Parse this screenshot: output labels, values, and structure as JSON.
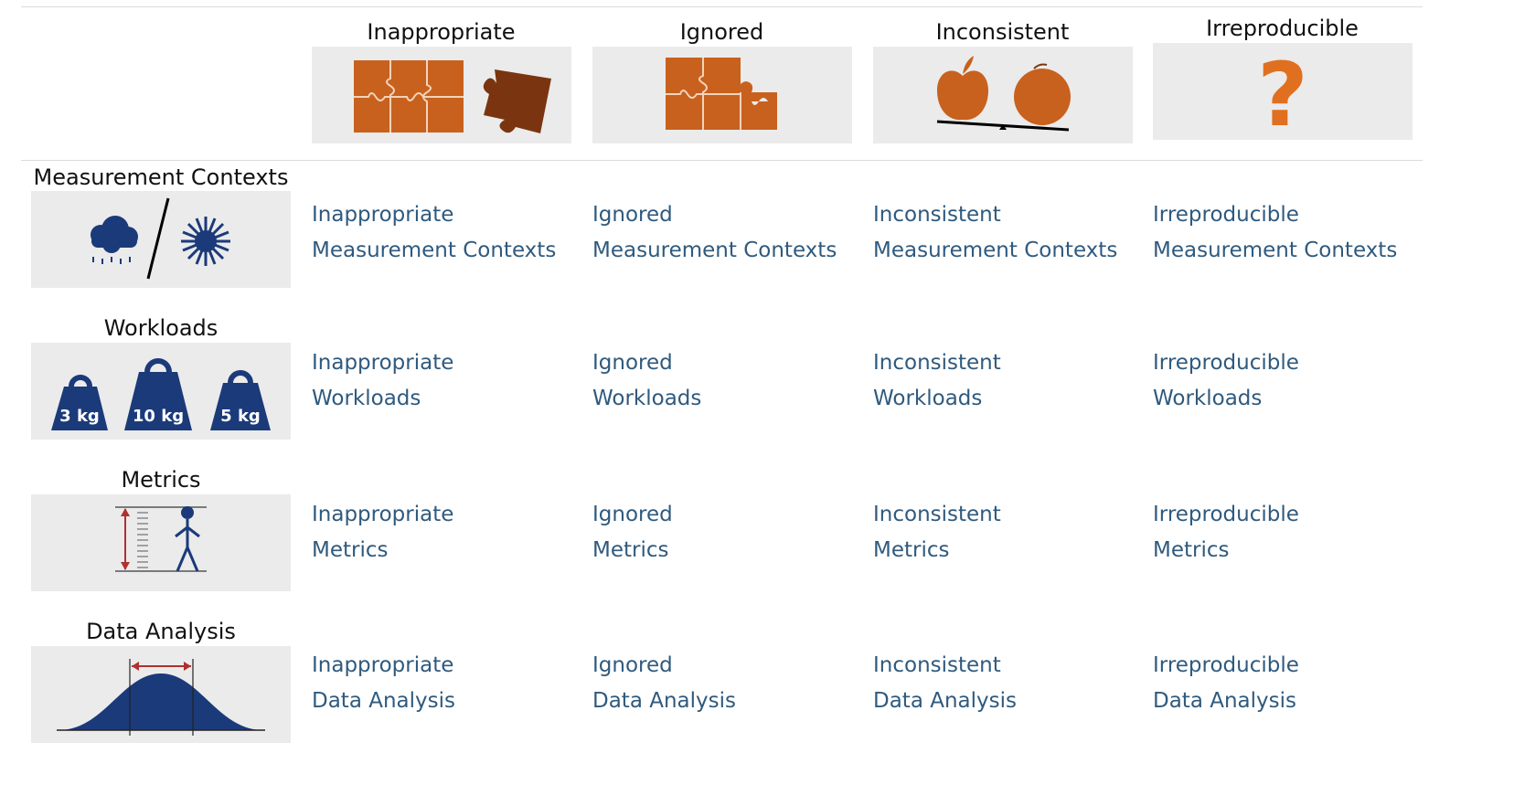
{
  "columns": [
    {
      "label": "Inappropriate",
      "icon": "mismatched-puzzle-icon"
    },
    {
      "label": "Ignored",
      "icon": "incomplete-puzzle-icon"
    },
    {
      "label": "Inconsistent",
      "icon": "apple-orange-scale-icon"
    },
    {
      "label": "Irreproducible",
      "icon": "question-mark-icon"
    }
  ],
  "rows": [
    {
      "label": "Measurement Contexts",
      "icon": "weather-rain-sun-icon"
    },
    {
      "label": "Workloads",
      "icon": "weights-icon",
      "weights": [
        "3 kg",
        "10 kg",
        "5 kg"
      ]
    },
    {
      "label": "Metrics",
      "icon": "height-measure-icon"
    },
    {
      "label": "Data Analysis",
      "icon": "bell-curve-icon"
    }
  ],
  "cells": [
    [
      {
        "line1": "Inappropriate",
        "line2": "Measurement Contexts"
      },
      {
        "line1": "Ignored",
        "line2": "Measurement Contexts"
      },
      {
        "line1": "Inconsistent",
        "line2": "Measurement Contexts"
      },
      {
        "line1": "Irreproducible",
        "line2": "Measurement Contexts"
      }
    ],
    [
      {
        "line1": "Inappropriate",
        "line2": "Workloads"
      },
      {
        "line1": "Ignored",
        "line2": "Workloads"
      },
      {
        "line1": "Inconsistent",
        "line2": "Workloads"
      },
      {
        "line1": "Irreproducible",
        "line2": "Workloads"
      }
    ],
    [
      {
        "line1": "Inappropriate",
        "line2": "Metrics"
      },
      {
        "line1": "Ignored",
        "line2": "Metrics"
      },
      {
        "line1": "Inconsistent",
        "line2": "Metrics"
      },
      {
        "line1": "Irreproducible",
        "line2": "Metrics"
      }
    ],
    [
      {
        "line1": "Inappropriate",
        "line2": "Data Analysis"
      },
      {
        "line1": "Ignored",
        "line2": "Data Analysis"
      },
      {
        "line1": "Inconsistent",
        "line2": "Data Analysis"
      },
      {
        "line1": "Irreproducible",
        "line2": "Data Analysis"
      }
    ]
  ],
  "colors": {
    "orange": "#c8611e",
    "dark_orange": "#7a3510",
    "navy": "#1b3a7a",
    "link": "#2f5a7e",
    "panel": "#ebebeb",
    "measure_red": "#b03030"
  }
}
